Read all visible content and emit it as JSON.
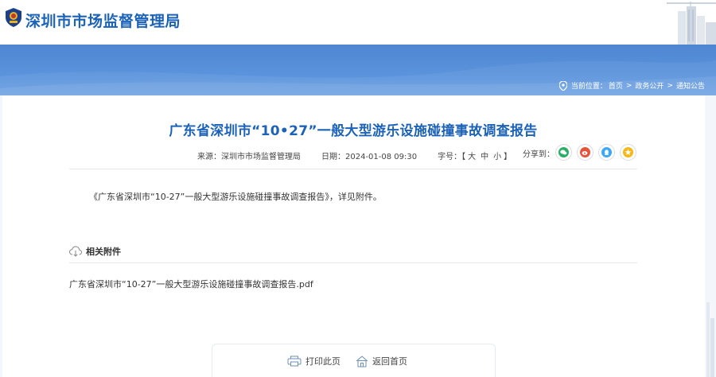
{
  "header": {
    "site_title": "深圳市市场监督管理局"
  },
  "breadcrumb": {
    "prefix": "当前位置：",
    "items": [
      "首页",
      "政务公开",
      "通知公告"
    ],
    "separator": ">"
  },
  "article": {
    "title": "广东省深圳市“10•27”一般大型游乐设施碰撞事故调查报告",
    "source_label": "来源：",
    "source": "深圳市市场监督管理局",
    "date_label": "日期：",
    "date": "2024-01-08 09:30",
    "font_label": "字号：",
    "font_open": "【",
    "font_large": "大",
    "font_medium": "中",
    "font_small": "小",
    "font_close": "】",
    "share_label": "分享到：",
    "share_icons": [
      "wechat-icon",
      "weibo-icon",
      "qq-icon",
      "qzone-icon"
    ],
    "body": "《广东省深圳市“10-27”一般大型游乐设施碰撞事故调查报告》，详见附件。"
  },
  "attachments": {
    "header": "相关附件",
    "files": [
      "广东省深圳市“10-27”一般大型游乐设施碰撞事故调查报告.pdf"
    ]
  },
  "actions": {
    "print": "打印此页",
    "home": "返回首页"
  },
  "colors": {
    "brand_blue": "#1c62b7",
    "banner_blue": "#5b93dc",
    "wechat": "#2aae67",
    "weibo": "#e6533b",
    "qq": "#3da8f5",
    "qzone": "#f5b818"
  }
}
